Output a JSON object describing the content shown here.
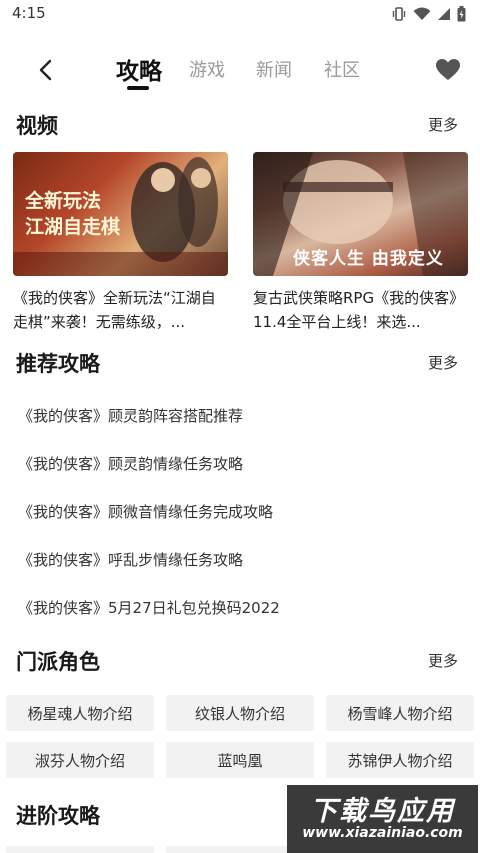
{
  "status_bar": {
    "time": "4:15"
  },
  "nav": {
    "tabs": [
      {
        "label": "攻略",
        "active": true
      },
      {
        "label": "游戏",
        "active": false
      },
      {
        "label": "新闻",
        "active": false
      },
      {
        "label": "社区",
        "active": false
      }
    ]
  },
  "videos": {
    "title": "视频",
    "more": "更多",
    "items": [
      {
        "thumb_text": "全新玩法 江湖自走棋",
        "title": "《我的侠客》全新玩法“江湖自走棋”来袭！无需练级，..."
      },
      {
        "thumb_text": "侠客人生 由我定义",
        "title": "复古武侠策略RPG《我的侠客》11.4全平台上线！来选..."
      }
    ]
  },
  "guides": {
    "title": "推荐攻略",
    "more": "更多",
    "items": [
      "《我的侠客》顾灵韵阵容搭配推荐",
      "《我的侠客》顾灵韵情缘任务攻略",
      "《我的侠客》顾微音情缘任务完成攻略",
      "《我的侠客》呼乱步情缘任务攻略",
      "《我的侠客》5月27日礼包兑换码2022"
    ]
  },
  "roles": {
    "title": "门派角色",
    "more": "更多",
    "items": [
      "杨星魂人物介绍",
      "纹银人物介绍",
      "杨雪峰人物介绍",
      "淑芬人物介绍",
      "蓝鸣凰",
      "苏锦伊人物介绍"
    ]
  },
  "advanced": {
    "title": "进阶攻略"
  },
  "watermark": {
    "top": "下载鸟应用",
    "bottom": "www.xiazainiao.com"
  },
  "colors": {
    "active_tab": "#111111",
    "inactive_tab": "#9a9a9a",
    "chip_bg": "#f2f2f2",
    "heart": "#555555"
  }
}
